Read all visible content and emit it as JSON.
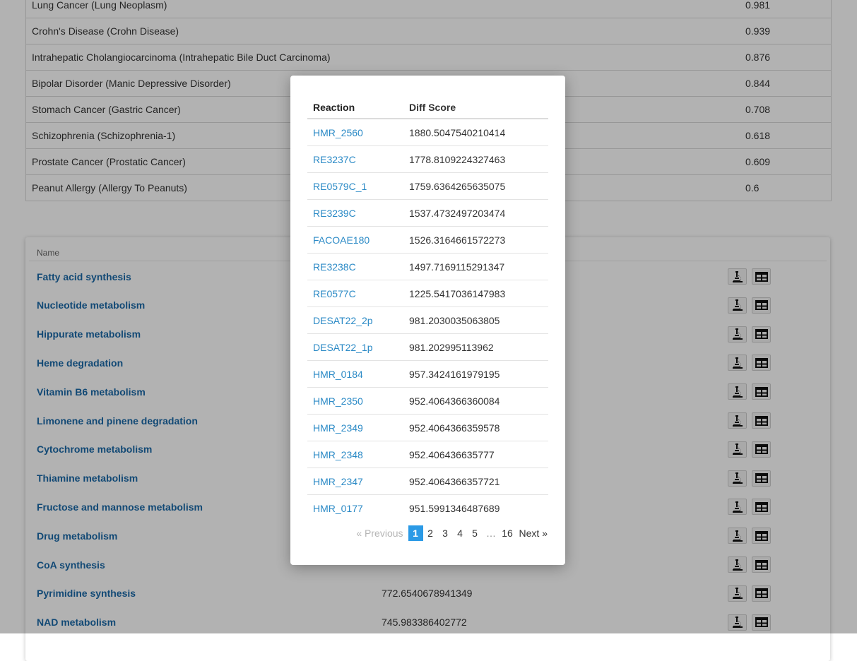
{
  "diseases": [
    {
      "name": "Lung Cancer (Lung Neoplasm)",
      "score": "0.981"
    },
    {
      "name": "Crohn's Disease (Crohn Disease)",
      "score": "0.939"
    },
    {
      "name": "Intrahepatic Cholangiocarcinoma (Intrahepatic Bile Duct Carcinoma)",
      "score": "0.876"
    },
    {
      "name": "Bipolar Disorder (Manic Depressive Disorder)",
      "score": "0.844"
    },
    {
      "name": "Stomach Cancer (Gastric Cancer)",
      "score": "0.708"
    },
    {
      "name": "Schizophrenia (Schizophrenia-1)",
      "score": "0.618"
    },
    {
      "name": "Prostate Cancer (Prostatic Cancer)",
      "score": "0.609"
    },
    {
      "name": "Peanut Allergy (Allergy To Peanuts)",
      "score": "0.6"
    }
  ],
  "pathways": {
    "header_name": "Name",
    "rows": [
      {
        "name": "Fatty acid synthesis",
        "score": ""
      },
      {
        "name": "Nucleotide metabolism",
        "score": ""
      },
      {
        "name": "Hippurate metabolism",
        "score": ""
      },
      {
        "name": "Heme degradation",
        "score": ""
      },
      {
        "name": "Vitamin B6 metabolism",
        "score": ""
      },
      {
        "name": "Limonene and pinene degradation",
        "score": ""
      },
      {
        "name": "Cytochrome metabolism",
        "score": ""
      },
      {
        "name": "Thiamine metabolism",
        "score": ""
      },
      {
        "name": "Fructose and mannose metabolism",
        "score": ""
      },
      {
        "name": "Drug metabolism",
        "score": ""
      },
      {
        "name": "CoA synthesis",
        "score": ""
      },
      {
        "name": "Pyrimidine synthesis",
        "score": "772.6540678941349"
      },
      {
        "name": "NAD metabolism",
        "score": "745.983386402772"
      }
    ],
    "icons": [
      "microscope-icon",
      "table-icon"
    ]
  },
  "modal": {
    "headers": {
      "reaction": "Reaction",
      "diff_score": "Diff Score"
    },
    "rows": [
      {
        "reaction": "HMR_2560",
        "score": "1880.5047540210414"
      },
      {
        "reaction": "RE3237C",
        "score": "1778.8109224327463"
      },
      {
        "reaction": "RE0579C_1",
        "score": "1759.6364265635075"
      },
      {
        "reaction": "RE3239C",
        "score": "1537.4732497203474"
      },
      {
        "reaction": "FACOAE180",
        "score": "1526.3164661572273"
      },
      {
        "reaction": "RE3238C",
        "score": "1497.7169115291347"
      },
      {
        "reaction": "RE0577C",
        "score": "1225.5417036147983"
      },
      {
        "reaction": "DESAT22_2p",
        "score": "981.2030035063805"
      },
      {
        "reaction": "DESAT22_1p",
        "score": "981.202995113962"
      },
      {
        "reaction": "HMR_0184",
        "score": "957.3424161979195"
      },
      {
        "reaction": "HMR_2350",
        "score": "952.4064366360084"
      },
      {
        "reaction": "HMR_2349",
        "score": "952.4064366359578"
      },
      {
        "reaction": "HMR_2348",
        "score": "952.406436635777"
      },
      {
        "reaction": "HMR_2347",
        "score": "952.4064366357721"
      },
      {
        "reaction": "HMR_0177",
        "score": "951.5991346487689"
      }
    ],
    "pagination": {
      "prev_label": "«  Previous",
      "pages": [
        "1",
        "2",
        "3",
        "4",
        "5"
      ],
      "active_page": "1",
      "ellipsis": "…",
      "last_page": "16",
      "next_label": "Next  »"
    }
  }
}
